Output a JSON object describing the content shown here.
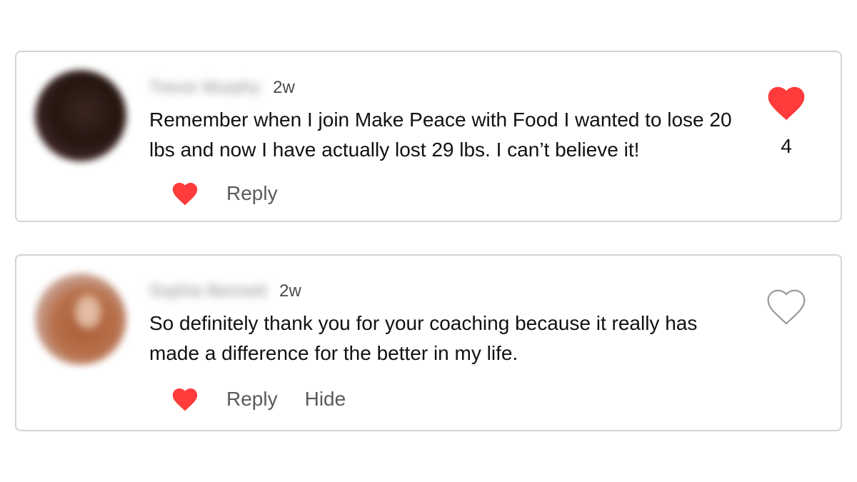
{
  "colors": {
    "heart_red": "#ff3b3b",
    "border": "#d4d4d4",
    "action_gray": "#5a5a5a"
  },
  "comments": [
    {
      "author": "Trevor Murphy",
      "time": "2w",
      "text": "Remember when I join Make Peace with Food I wanted to lose 20 lbs and now I have actually lost 29 lbs. I can’t believe it!",
      "liked": true,
      "like_count": "4",
      "actions": {
        "reply": "Reply"
      }
    },
    {
      "author": "Sophia Bennett",
      "time": "2w",
      "text": "So definitely thank you for your coaching because it really has made a difference for the better in my life.",
      "liked": false,
      "like_count": "",
      "actions": {
        "reply": "Reply",
        "hide": "Hide"
      }
    }
  ]
}
